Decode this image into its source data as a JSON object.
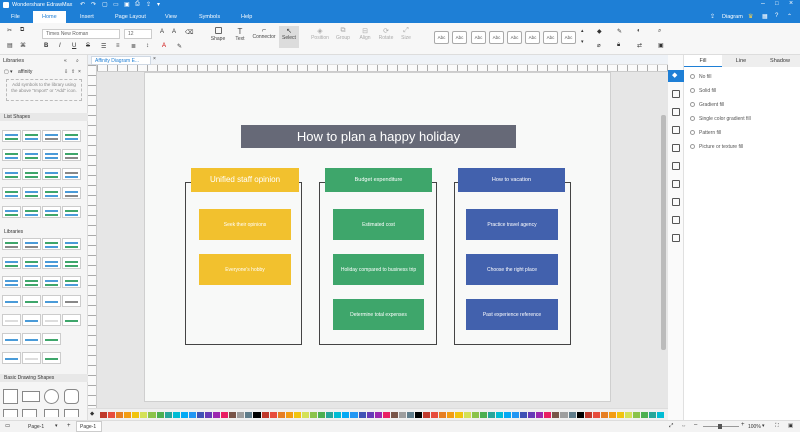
{
  "app": {
    "title": "Wondershare EdrawMax"
  },
  "menu": {
    "file": "File",
    "home": "Home",
    "insert": "Insert",
    "page_layout": "Page Layout",
    "view": "View",
    "symbols": "Symbols",
    "help": "Help"
  },
  "user": {
    "label": "Diagram"
  },
  "ribbon": {
    "font_name": "Times New Roman",
    "font_size": "12",
    "shape": "Shape",
    "text": "Text",
    "connector": "Connector",
    "select": "Select",
    "position": "Position",
    "group": "Group",
    "align": "Align",
    "rotate": "Rotate",
    "size": "Size",
    "styles": [
      "Abc",
      "Abc",
      "Abc",
      "Abc",
      "Abc",
      "Abc",
      "Abc",
      "Abc",
      "Abc",
      "Abc"
    ]
  },
  "libraries": {
    "title": "Libraries",
    "search_value": "affinity",
    "hint": "Add symbols to the library using the above \"Import\" or \"Add\" icon.",
    "section_list": "List Shapes",
    "section_libraries": "Libraries",
    "section_basic": "Basic Drawing Shapes"
  },
  "doc_tab": {
    "label": "Affinity Diagram E..."
  },
  "diagram": {
    "title": "How to plan a happy holiday",
    "columns": [
      {
        "header": "Unified staff opinion",
        "cards": [
          "Seek their opinions",
          "Everyone's hobby"
        ]
      },
      {
        "header": "Budget expenditure",
        "cards": [
          "Estimated cost",
          "Holiday compared to business trip",
          "Determine total expenses"
        ]
      },
      {
        "header": "How to vacation",
        "cards": [
          "Practice travel agency",
          "Choose the right place",
          "Past experience reference"
        ]
      }
    ]
  },
  "colors": {
    "yellow": "#f2c12e",
    "green": "#3ea66b",
    "blue": "#4261ad",
    "title_bg": "#666977"
  },
  "right_panel": {
    "tabs": [
      "Fill",
      "Line",
      "Shadow"
    ],
    "options": [
      "No fill",
      "Solid fill",
      "Gradient fill",
      "Single color gradient fill",
      "Pattern fill",
      "Picture or texture fill"
    ]
  },
  "status": {
    "page_select": "Page-1",
    "page_tab": "Page-1",
    "zoom": "100%"
  }
}
